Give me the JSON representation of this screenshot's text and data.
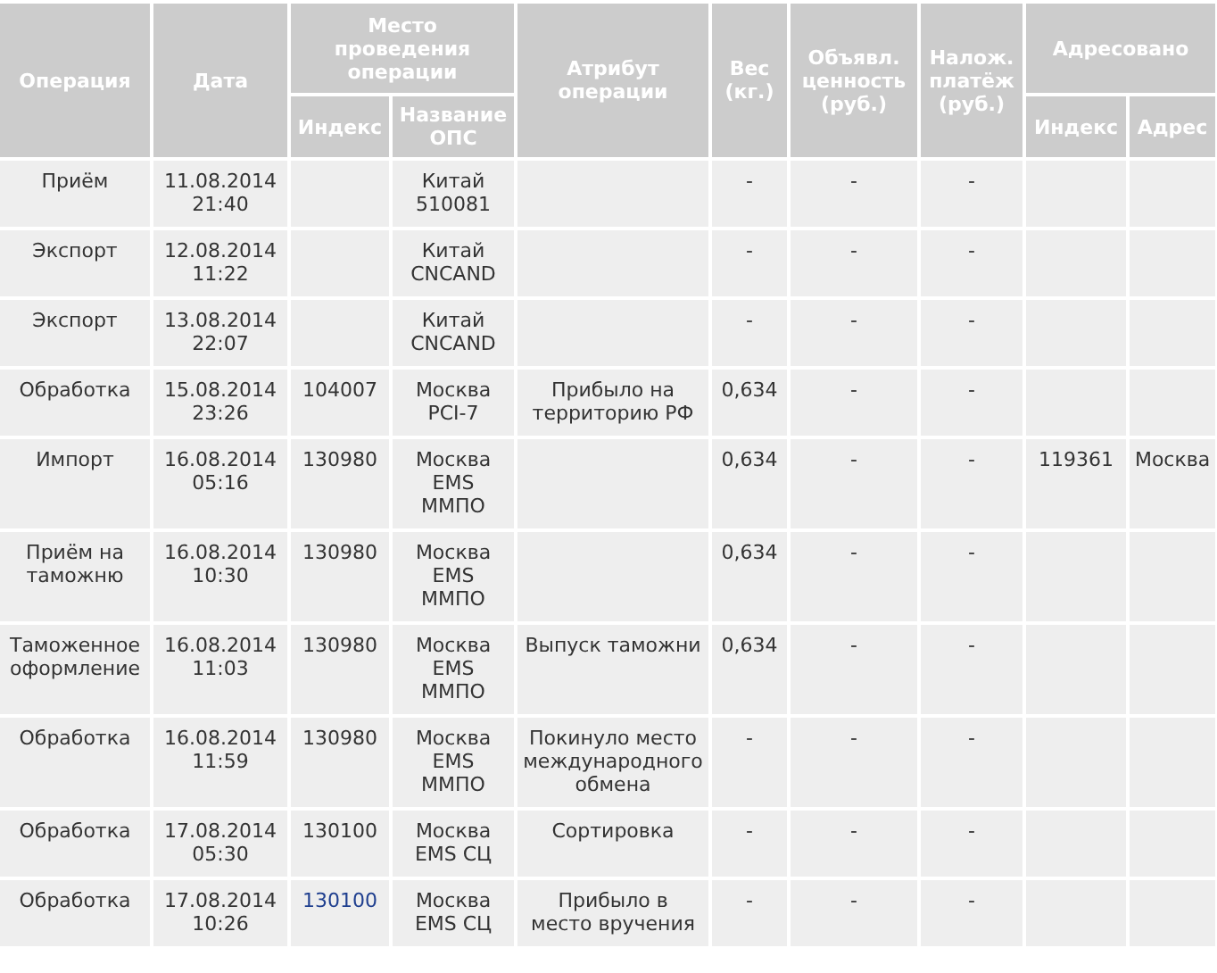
{
  "table": {
    "columns": [
      {
        "label": "Операция"
      },
      {
        "label": "Дата"
      },
      {
        "label": "Место\nпроведения\nоперации",
        "children": [
          {
            "label": "Индекс"
          },
          {
            "label": "Название\nОПС"
          }
        ]
      },
      {
        "label": "Атрибут\nоперации"
      },
      {
        "label": "Вес\n(кг.)"
      },
      {
        "label": "Объявл.\nценность\n(руб.)"
      },
      {
        "label": "Налож.\nплатёж\n(руб.)"
      },
      {
        "label": "Адресовано",
        "children": [
          {
            "label": "Индекс"
          },
          {
            "label": "Адрес"
          }
        ]
      }
    ],
    "rows": [
      {
        "operation": "Приём",
        "date": "11.08.2014\n21:40",
        "office": "Китай\n510081",
        "weight": "-",
        "declared_value": "-",
        "cod": "-"
      },
      {
        "operation": "Экспорт",
        "date": "12.08.2014\n11:22",
        "office": "Китай\nCNCAND",
        "weight": "-",
        "declared_value": "-",
        "cod": "-"
      },
      {
        "operation": "Экспорт",
        "date": "13.08.2014\n22:07",
        "office": "Китай\nCNCAND",
        "weight": "-",
        "declared_value": "-",
        "cod": "-"
      },
      {
        "operation": "Обработка",
        "date": "15.08.2014\n23:26",
        "postcode": "104007",
        "postcode_link": false,
        "office": "Москва\nPCI-7",
        "attribute": "Прибыло на\nтерриторию РФ",
        "weight": "0,634",
        "declared_value": "-",
        "cod": "-"
      },
      {
        "operation": "Импорт",
        "date": "16.08.2014\n05:16",
        "postcode": "130980",
        "postcode_link": false,
        "office": "Москва\nEMS\nММПО",
        "weight": "0,634",
        "declared_value": "-",
        "cod": "-",
        "recipient_index": "119361",
        "recipient_address": "Москва"
      },
      {
        "operation": "Приём на\nтаможню",
        "date": "16.08.2014\n10:30",
        "postcode": "130980",
        "postcode_link": false,
        "office": "Москва\nEMS\nММПО",
        "weight": "0,634",
        "declared_value": "-",
        "cod": "-"
      },
      {
        "operation": "Таможенное\nоформление",
        "date": "16.08.2014\n11:03",
        "postcode": "130980",
        "postcode_link": false,
        "office": "Москва\nEMS\nММПО",
        "attribute": "Выпуск таможни",
        "weight": "0,634",
        "declared_value": "-",
        "cod": "-"
      },
      {
        "operation": "Обработка",
        "date": "16.08.2014\n11:59",
        "postcode": "130980",
        "postcode_link": false,
        "office": "Москва\nEMS\nММПО",
        "attribute": "Покинуло место\nмеждународного\nобмена",
        "weight": "-",
        "declared_value": "-",
        "cod": "-"
      },
      {
        "operation": "Обработка",
        "date": "17.08.2014\n05:30",
        "postcode": "130100",
        "postcode_link": false,
        "office": "Москва\nEMS СЦ",
        "attribute": "Сортировка",
        "weight": "-",
        "declared_value": "-",
        "cod": "-"
      },
      {
        "operation": "Обработка",
        "date": "17.08.2014\n10:26",
        "postcode": "130100",
        "postcode_link": true,
        "office": "Москва\nEMS СЦ",
        "attribute": "Прибыло в\nместо вручения",
        "weight": "-",
        "declared_value": "-",
        "cod": "-"
      }
    ]
  }
}
